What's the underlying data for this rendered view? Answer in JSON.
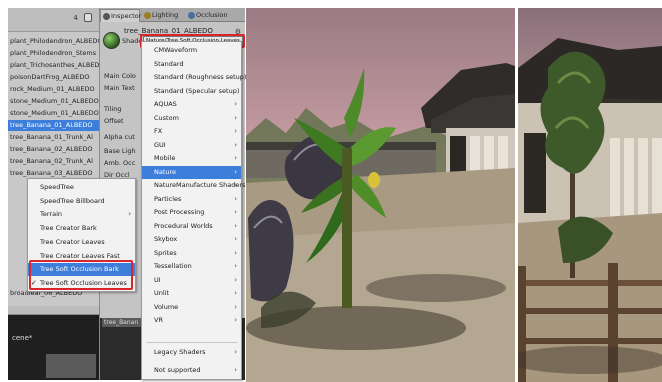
{
  "hierarchy": {
    "count": "4",
    "items": [
      {
        "label": "plant_Philodendron_ALBEDO",
        "selected": false
      },
      {
        "label": "plant_Philodendron_Stems",
        "selected": false
      },
      {
        "label": "plant_Trichosanthes_ALBEDO",
        "selected": false
      },
      {
        "label": "poisonDartFrog_ALBEDO",
        "selected": false
      },
      {
        "label": "rock_Medium_01_ALBEDO",
        "selected": false
      },
      {
        "label": "stone_Medium_01_ALBEDO",
        "selected": false
      },
      {
        "label": "stone_Medium_01_ALBEDO",
        "selected": false
      },
      {
        "label": "tree_Banana_01_ALBEDO",
        "selected": true
      },
      {
        "label": "tree_Banana_01_Trunk_Al",
        "selected": false
      },
      {
        "label": "tree_Banana_02_ALBEDO",
        "selected": false
      },
      {
        "label": "tree_Banana_02_Trunk_Al",
        "selected": false
      },
      {
        "label": "tree_Banana_03_ALBEDO",
        "selected": false
      }
    ],
    "footer_item": "broadleaf_06_ALBEDO",
    "bottom_bar": "",
    "scene_label": "cene*"
  },
  "inspector": {
    "tabs": [
      {
        "label": "Inspector",
        "active": true
      },
      {
        "label": "Lighting",
        "active": false
      },
      {
        "label": "Occlusion",
        "active": false
      }
    ],
    "material_name": "tree_Banana_01_ALBEDO",
    "shader_label": "Shader",
    "shader_value": "Nature/Tree Soft Occlusion Leaves",
    "properties": [
      "Main Colo",
      "Main Text",
      "Tiling",
      "Offset",
      "Alpha cut",
      "Base Ligh",
      "Amb. Occ",
      "Dir Occl"
    ],
    "sub_panel_title": "tree_Banan"
  },
  "shader_menu": {
    "items": [
      {
        "label": "CMWaveform",
        "submenu": false,
        "highlighted": false
      },
      {
        "label": "Standard",
        "submenu": false,
        "highlighted": false
      },
      {
        "label": "Standard (Roughness setup)",
        "submenu": false,
        "highlighted": false
      },
      {
        "label": "Standard (Specular setup)",
        "submenu": false,
        "highlighted": false
      },
      {
        "label": "AQUAS",
        "submenu": true,
        "highlighted": false
      },
      {
        "label": "Custom",
        "submenu": true,
        "highlighted": false
      },
      {
        "label": "FX",
        "submenu": true,
        "highlighted": false
      },
      {
        "label": "GUI",
        "submenu": true,
        "highlighted": false
      },
      {
        "label": "Mobile",
        "submenu": true,
        "highlighted": false
      },
      {
        "label": "Nature",
        "submenu": true,
        "highlighted": true
      },
      {
        "label": "NatureManufacture Shaders",
        "submenu": true,
        "highlighted": false
      },
      {
        "label": "Particles",
        "submenu": true,
        "highlighted": false
      },
      {
        "label": "Post Processing",
        "submenu": true,
        "highlighted": false
      },
      {
        "label": "Procedural Worlds",
        "submenu": true,
        "highlighted": false
      },
      {
        "label": "Skybox",
        "submenu": true,
        "highlighted": false
      },
      {
        "label": "Sprites",
        "submenu": true,
        "highlighted": false
      },
      {
        "label": "Tessellation",
        "submenu": true,
        "highlighted": false
      },
      {
        "label": "UI",
        "submenu": true,
        "highlighted": false
      },
      {
        "label": "Unlit",
        "submenu": true,
        "highlighted": false
      },
      {
        "label": "Volume",
        "submenu": true,
        "highlighted": false
      },
      {
        "label": "VR",
        "submenu": true,
        "highlighted": false
      }
    ],
    "footer_items": [
      {
        "label": "Legacy Shaders",
        "submenu": true
      },
      {
        "label": "Not supported",
        "submenu": true
      }
    ]
  },
  "nature_menu": {
    "items": [
      {
        "label": "SpeedTree",
        "submenu": false,
        "highlighted": false,
        "checked": false
      },
      {
        "label": "SpeedTree Billboard",
        "submenu": false,
        "highlighted": false,
        "checked": false
      },
      {
        "label": "Terrain",
        "submenu": true,
        "highlighted": false,
        "checked": false
      },
      {
        "label": "Tree Creator Bark",
        "submenu": false,
        "highlighted": false,
        "checked": false
      },
      {
        "label": "Tree Creator Leaves",
        "submenu": false,
        "highlighted": false,
        "checked": false
      },
      {
        "label": "Tree Creator Leaves Fast",
        "submenu": false,
        "highlighted": false,
        "checked": false
      },
      {
        "label": "Tree Soft Occlusion Bark",
        "submenu": false,
        "highlighted": true,
        "checked": false
      },
      {
        "label": "Tree Soft Occlusion Leaves",
        "submenu": false,
        "highlighted": false,
        "checked": true
      }
    ]
  },
  "colors": {
    "selection_blue": "#3d7edb",
    "highlight_red": "#d8262a",
    "panel_gray": "#c4c4c4"
  },
  "icons": {
    "lock": "lock-icon",
    "submenu": "chevron-right-icon",
    "check": "checkmark-icon",
    "inspector_tab": "info-icon",
    "lighting_tab": "light-bulb-icon",
    "occlusion_tab": "occlusion-icon",
    "material": "material-sphere-icon"
  }
}
